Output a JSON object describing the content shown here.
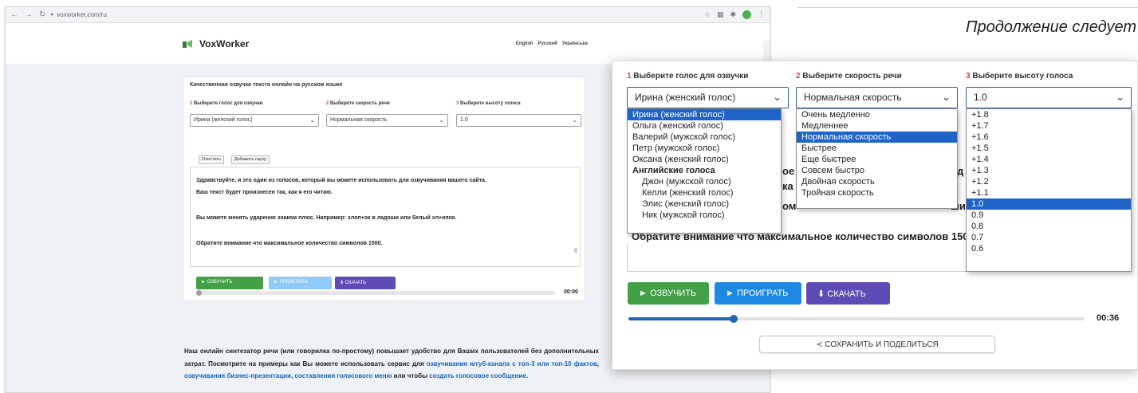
{
  "browser": {
    "url": "voxworker.com/ru"
  },
  "site": {
    "logo": "VoxWorker",
    "languages": [
      "English",
      "Русский",
      "Українська"
    ]
  },
  "card": {
    "title": "Качественная озвучка текста онлайн на русском языке",
    "voice_label_num": "1",
    "voice_label": "Выберите голос для озвучки",
    "speed_label_num": "2",
    "speed_label": "Выберите скорость речи",
    "pitch_label_num": "3",
    "pitch_label": "Выберите высоту голоса",
    "voice_value": "Ирина (женский голос)",
    "speed_value": "Нормальная скорость",
    "pitch_value": "1.0",
    "clear_button": "Очистить",
    "pause_button": "Добавить паузу",
    "text_lines": [
      "Здравствуйте, и это один из голосов, который вы можете использовать для озвучивания вашего сайта.",
      "Ваш текст будет произнесен так, как я его читаю.",
      "Вы можете менять ударение знаком плюс. Например: хлоп+ок в ладоши или белый хл+опок.",
      "Обратите внимание что максимальное количество символов 1500."
    ],
    "speak_button": "► ОЗВУЧИТЬ",
    "play_button": "► ПРОИГРАТЬ",
    "download_button": "⬇ СКАЧАТЬ",
    "time": "00:00"
  },
  "body_text": {
    "p1": "Наш онлайн синтезатор речи (или говорилка по-простому) повышает удобство для Ваших пользователей без дополнительных затрат. Посмотрите на примеры как Вы можете использовать сервис для ",
    "link1": "озвучивания ютуб-канала с топ-3 или топ-10 фактов",
    "sep1": ", ",
    "link2": "озвучивания бизнес-презентации",
    "sep2": ", ",
    "link3": "составления голосового меню",
    "sep3": " или чтобы ",
    "link4": "создать голосовое сообщение",
    "end": "."
  },
  "heading": {
    "continuation": "Продолжение следует"
  },
  "zoom": {
    "voice_label_num": "1",
    "voice_label": "Выберите голос для озвучки",
    "speed_label_num": "2",
    "speed_label": "Выберите скорость речи",
    "pitch_label_num": "3",
    "pitch_label": "Выберите высоту голоса",
    "voice_value": "Ирина (женский голос)",
    "speed_value": "Нормальная скорость",
    "pitch_value": "1.0",
    "voice_options": {
      "o1": "Ирина (женский голос)",
      "o2": "Ольга (женский голос)",
      "o3": "Валерий (мужской голос)",
      "o4": "Петр (мужской голос)",
      "o5": "Оксана (женский голос)",
      "group": "Английские голоса",
      "o6": "Джон (мужской голос)",
      "o7": "Келли (женский голос)",
      "o8": "Элис (женский голос)",
      "o9": "Ник (мужской голос)"
    },
    "speed_options": {
      "o1": "Очень медленно",
      "o2": "Медленнее",
      "o3": "Нормальная скорость",
      "o4": "Быстрее",
      "o5": "Еще быстрее",
      "o6": "Совсем быстро",
      "o7": "Двойная скорость",
      "o8": "Тройная скорость"
    },
    "pitch_options": [
      "+1.8",
      "+1.7",
      "+1.6",
      "+1.5",
      "+1.4",
      "+1.3",
      "+1.2",
      "+1.1",
      "1.0",
      "0.9",
      "0.8",
      "0.7",
      "0.6"
    ],
    "peek_text_1": "ое",
    "peek_text_2": "ка",
    "peek_text_3": "ом",
    "peek_text_4": "д",
    "peek_text_5": "ши",
    "bottom_text": "Обратите внимание что максимальное количество символов 1500.",
    "speak_button": "► ОЗВУЧИТЬ",
    "play_button": "► ПРОИГРАТЬ",
    "download_button": "⬇ СКАЧАТЬ",
    "progress": 0.23,
    "time": "00:36",
    "share_button": "≺ СОХРАНИТЬ И ПОДЕЛИТЬСЯ"
  },
  "colors": {
    "accent_blue": "#1f66b3",
    "select_highlight": "#1e64c8",
    "speak_green": "#43a047",
    "play_blue": "#1e88e5",
    "download_purple": "#5e4bb5",
    "label_number_red": "#e53935"
  }
}
